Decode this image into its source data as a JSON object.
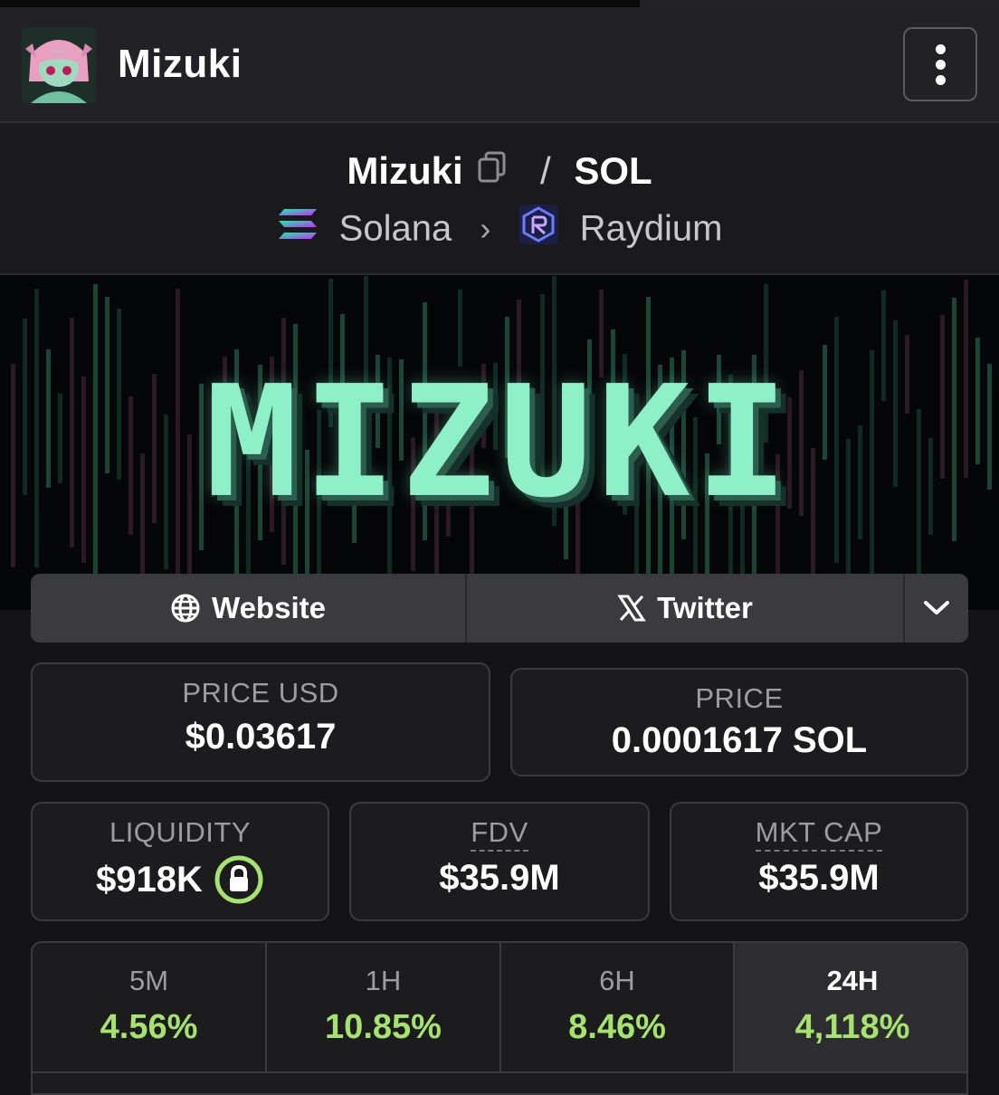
{
  "page_progress": 0.64,
  "header": {
    "title": "Mizuki",
    "avatar_icon": "avatar-image",
    "menu_icon": "kebab-menu-icon"
  },
  "pair": {
    "base": "Mizuki",
    "quote": "SOL",
    "separator": "/",
    "chain": "Solana",
    "dex": "Raydium"
  },
  "banner": {
    "text": "MIZUKI",
    "accent": "#8ef0c8"
  },
  "links": {
    "website": "Website",
    "twitter": "Twitter"
  },
  "stats": {
    "price_usd_label": "PRICE USD",
    "price_usd": "$0.03617",
    "price_label": "PRICE",
    "price": "0.0001617 SOL",
    "liquidity_label": "LIQUIDITY",
    "liquidity": "$918K",
    "fdv_label": "FDV",
    "fdv": "$35.9M",
    "mktcap_label": "MKT CAP",
    "mktcap": "$35.9M"
  },
  "changes": [
    {
      "label": "5M",
      "value": "4.56%"
    },
    {
      "label": "1H",
      "value": "10.85%"
    },
    {
      "label": "6H",
      "value": "8.46%"
    },
    {
      "label": "24H",
      "value": "4,118%"
    }
  ],
  "colors": {
    "positive": "#a6e36e",
    "lock": "#a6e36e"
  }
}
